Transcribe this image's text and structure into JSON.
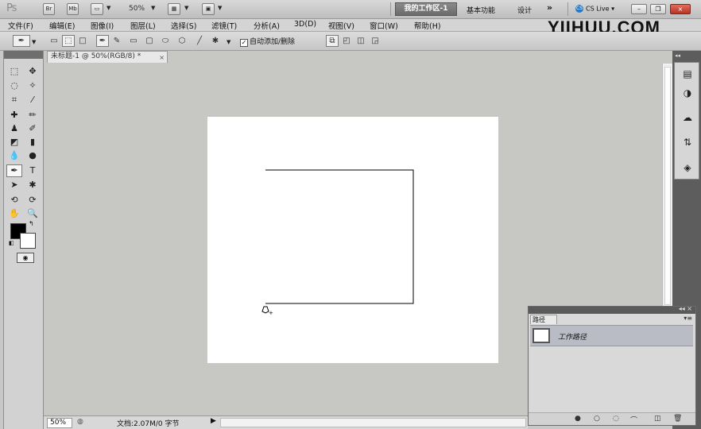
{
  "appbar": {
    "logo": "Ps",
    "br_label": "Br",
    "mb_label": "Mb",
    "zoom": "50%",
    "workspace_active": "我的工作区-1",
    "workspace_basic": "基本功能",
    "workspace_design": "设计",
    "more": "»",
    "cs_live": "CS Live",
    "cs_live_badge": "CS"
  },
  "watermark": "YIIHUU.COM",
  "menu": [
    {
      "label": "文件(F)"
    },
    {
      "label": "编辑(E)"
    },
    {
      "label": "图像(I)"
    },
    {
      "label": "图层(L)"
    },
    {
      "label": "选择(S)"
    },
    {
      "label": "滤镜(T)"
    },
    {
      "label": "分析(A)"
    },
    {
      "label": "3D(D)"
    },
    {
      "label": "视图(V)"
    },
    {
      "label": "窗口(W)"
    },
    {
      "label": "帮助(H)"
    }
  ],
  "options": {
    "auto_add_delete": "自动添加/删除",
    "auto_add_delete_checked": true
  },
  "document": {
    "tab_title": "未标题-1 @ 50%(RGB/8) *",
    "path_color": "#000000",
    "canvas_color": "#ffffff"
  },
  "paths_panel": {
    "tab": "路径",
    "items": [
      {
        "name": "工作路径"
      }
    ]
  },
  "status": {
    "zoom": "50%",
    "doc_info": "文档:2.07M/0 字节"
  },
  "colors": {
    "foreground": "#000000",
    "background": "#ffffff",
    "active_workspace": "#767676",
    "dock_background": "#5d5d5d"
  },
  "icons": {
    "close": "×",
    "check": "✓",
    "pen": "✒",
    "arrow_right": "▶"
  }
}
